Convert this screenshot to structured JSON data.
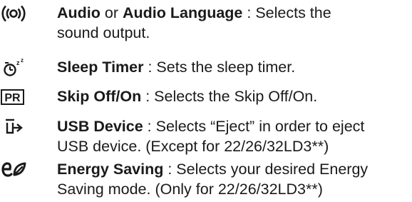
{
  "entries": [
    {
      "icon": "audio-icon",
      "term1": "Audio",
      "joiner": " or ",
      "term2": "Audio Language",
      "desc_line1": " : Selects the",
      "desc_line2": "sound output."
    },
    {
      "icon": "sleep-timer-icon",
      "term": "Sleep Timer",
      "desc": " : Sets the sleep timer."
    },
    {
      "icon": "pr-icon",
      "icon_text": "PR",
      "term": "Skip Off/On",
      "desc": " : Selects the Skip Off/On."
    },
    {
      "icon": "usb-eject-icon",
      "term": "USB Device",
      "desc_line1": " : Selects “Eject” in order to eject",
      "desc_line2": "USB device. (Except for 22/26/32LD3**)"
    },
    {
      "icon": "energy-saving-icon",
      "term": "Energy Saving",
      "desc_line1": " : Selects your desired Energy",
      "desc_line2": "Saving mode. (Only for 22/26/32LD3**)"
    }
  ],
  "colors": {
    "text": "#1a1a1a"
  }
}
